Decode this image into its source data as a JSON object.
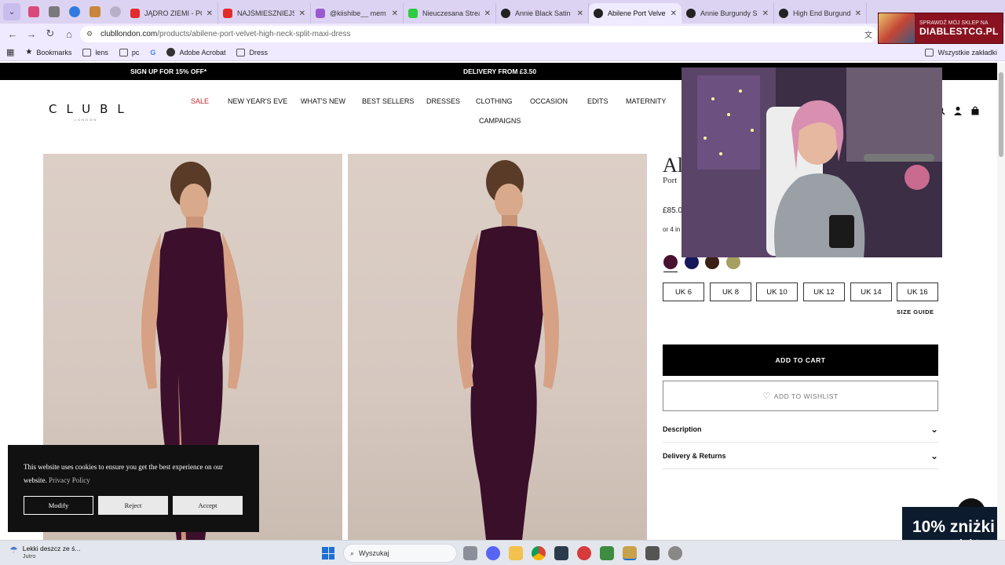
{
  "browser": {
    "tabs": [
      {
        "title": "JĄDRO ZIEMI - POWI",
        "color": "#e32b2b"
      },
      {
        "title": "NAJŚMIESZNIEJSZE",
        "color": "#e32b2b"
      },
      {
        "title": "@kiishibe__ mem",
        "color": "#9b59d0"
      },
      {
        "title": "Nieuczesana Stream",
        "color": "#2ecc40"
      },
      {
        "title": "Annie Black Satin Bo",
        "color": "#222222"
      },
      {
        "title": "Abilene Port Velvet",
        "color": "#222222"
      },
      {
        "title": "Annie Burgundy Sat",
        "color": "#222222"
      },
      {
        "title": "High End Burgundy",
        "color": "#222222"
      }
    ],
    "active_tab_index": 5,
    "url_host": "clubllondon.com",
    "url_path": "/products/abilene-port-velvet-high-neck-split-maxi-dress",
    "bookmarks": [
      "Bookmarks",
      "lens",
      "pc",
      "",
      "Adobe Acrobat",
      "Dress"
    ],
    "all_bookmarks": "Wszystkie zakładki"
  },
  "ad_top": {
    "small": "SPRAWDŹ MÓJ SKLEP NA",
    "big": "DIABLESTCG.PL"
  },
  "promo": {
    "left": "SIGN UP FOR 15% OFF*",
    "center": "DELIVERY FROM £3.50"
  },
  "site": {
    "logo": "CLUBL",
    "logo_sub": "LONDON",
    "nav": [
      "SALE",
      "NEW YEAR'S EVE",
      "WHAT'S NEW",
      "BEST SELLERS",
      "DRESSES",
      "CLOTHING",
      "OCCASION",
      "EDITS",
      "MATERNITY",
      "CAMPAIGNS"
    ]
  },
  "product": {
    "name_partial": "Al",
    "subtitle_partial": "Port",
    "price_partial": "£85.0",
    "klarna_partial": "or 4 in",
    "swatches": [
      "#4a1030",
      "#14185a",
      "#3a2015",
      "#a5a060"
    ],
    "sizes": [
      "UK 6",
      "UK 8",
      "UK 10",
      "UK 12",
      "UK 14",
      "UK 16"
    ],
    "size_guide": "SIZE GUIDE",
    "add_to_cart": "ADD TO CART",
    "wishlist": "ADD TO WISHLIST",
    "accordions": [
      "Description",
      "Delivery & Returns"
    ]
  },
  "cookie": {
    "text": "This website uses cookies to ensure you get the best experience on our website.",
    "link": "Privacy Policy",
    "modify": "Modify",
    "reject": "Reject",
    "accept": "Accept"
  },
  "ad_bottom": {
    "big": "10% zniżki",
    "small": "na produkty"
  },
  "taskbar": {
    "weather_title": "Lekki deszcz ze ś...",
    "weather_sub": "Jutro",
    "search": "Wyszukaj"
  }
}
